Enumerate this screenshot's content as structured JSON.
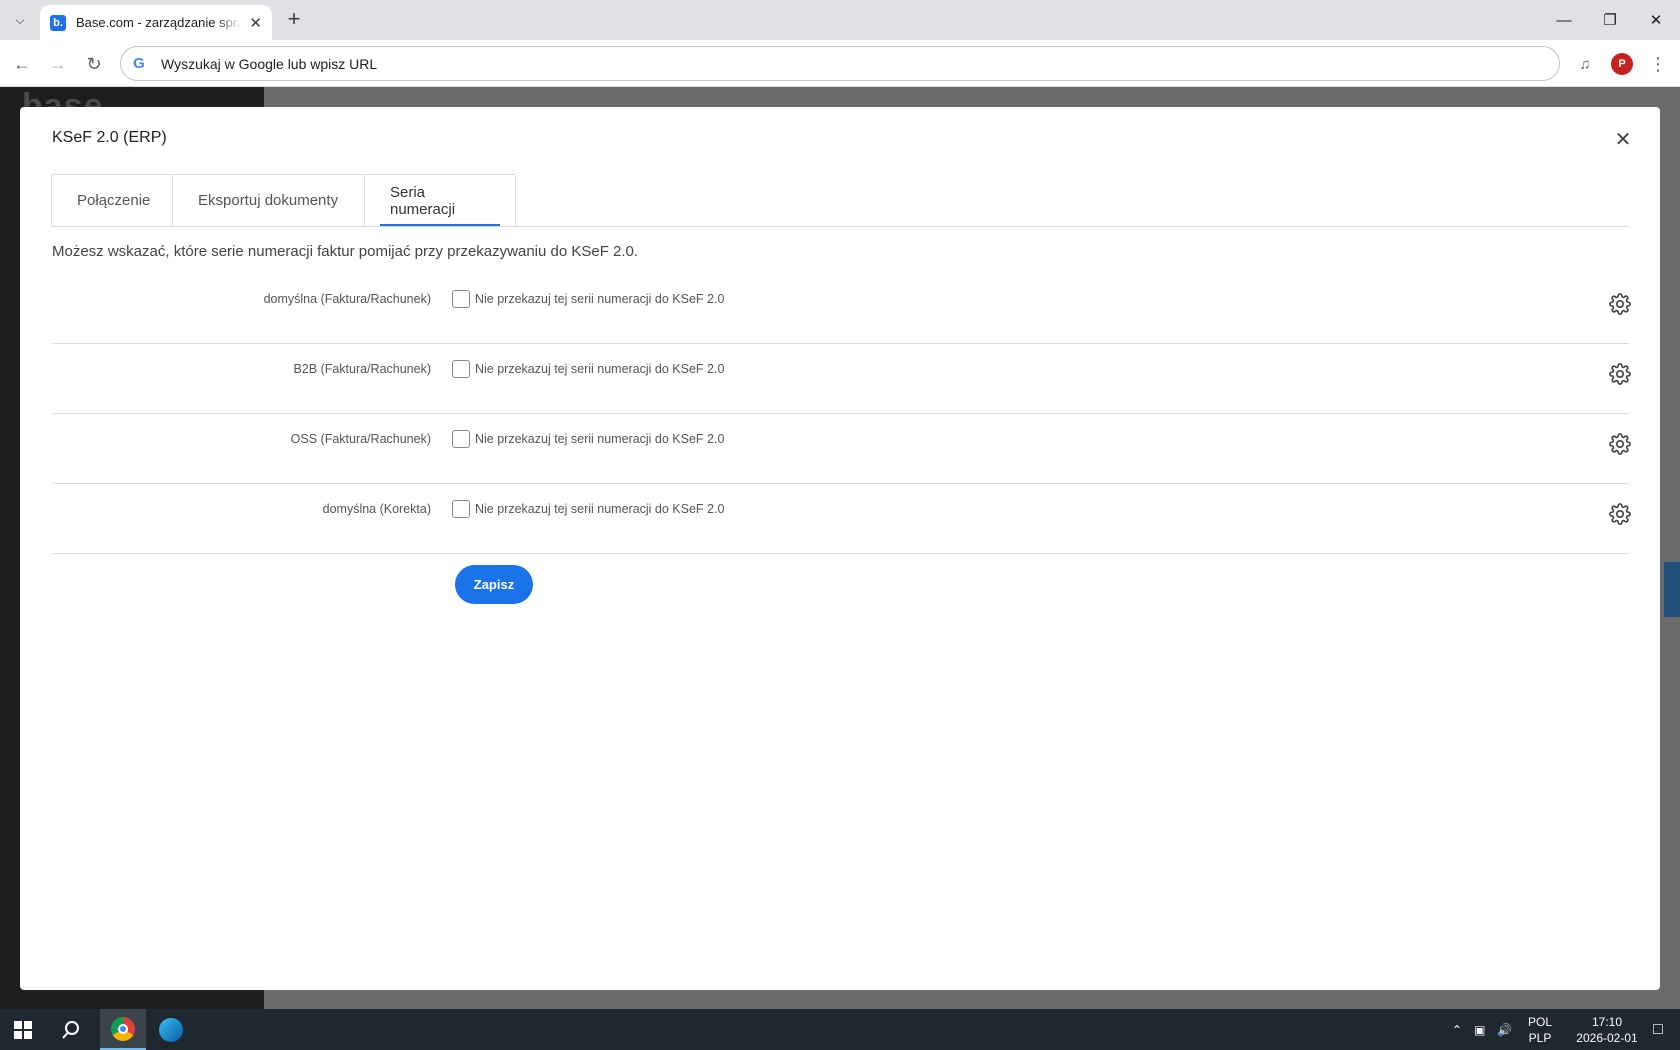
{
  "browser": {
    "tab_title": "Base.com - zarządzanie sprzedażą",
    "favicon_letter": "b.",
    "omnibox_placeholder": "Wyszukaj w Google lub wpisz URL",
    "profile_initial": "P"
  },
  "modal": {
    "title": "KSeF 2.0 (ERP)",
    "close_icon": "close-icon",
    "tabs": [
      {
        "label": "Połączenie",
        "active": false
      },
      {
        "label": "Eksportuj dokumenty",
        "active": false
      },
      {
        "label": "Seria numeracji",
        "active": true
      }
    ],
    "description": "Możesz wskazać, które serie numeracji faktur pomijać przy przekazywaniu do KSeF 2.0.",
    "series": [
      {
        "name": "domyślna (Faktura/Rachunek)",
        "checkbox_label": "Nie przekazuj tej serii numeracji do KSeF 2.0",
        "checked": false
      },
      {
        "name": "B2B (Faktura/Rachunek)",
        "checkbox_label": "Nie przekazuj tej serii numeracji do KSeF 2.0",
        "checked": false
      },
      {
        "name": "OSS (Faktura/Rachunek)",
        "checkbox_label": "Nie przekazuj tej serii numeracji do KSeF 2.0",
        "checked": false
      },
      {
        "name": "domyślna (Korekta)",
        "checkbox_label": "Nie przekazuj tej serii numeracji do KSeF 2.0",
        "checked": false
      }
    ],
    "save_label": "Zapisz",
    "accent_color": "#1a73e8"
  },
  "taskbar": {
    "lang_top": "POL",
    "lang_bottom": "PLP",
    "time": "17:10",
    "date": "2026-02-01"
  }
}
